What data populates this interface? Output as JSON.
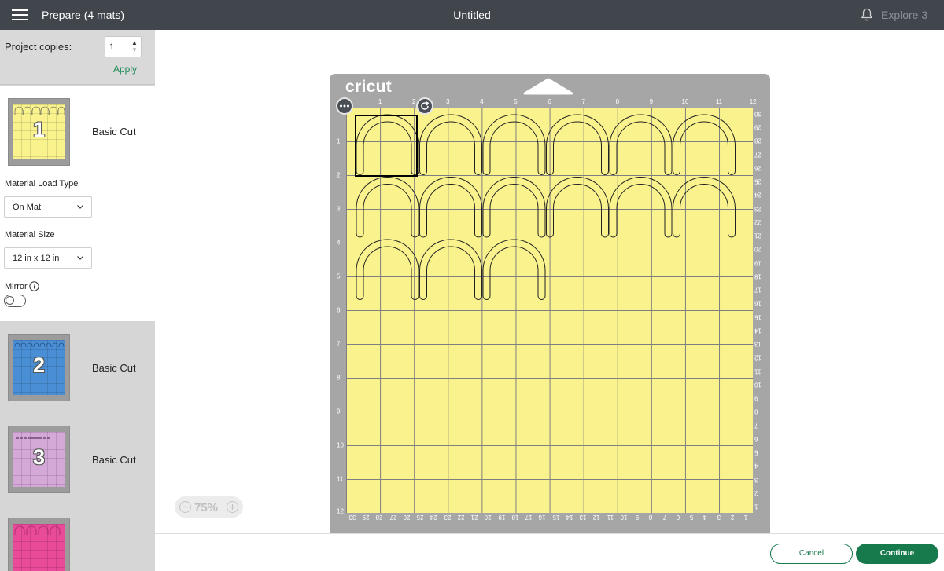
{
  "header": {
    "app_title": "Prepare (4 mats)",
    "doc_title": "Untitled",
    "machine": "Explore 3"
  },
  "sidebar": {
    "copies_label": "Project copies:",
    "copies_value": "1",
    "apply_label": "Apply",
    "mats": [
      {
        "number": "1",
        "label": "Basic Cut",
        "color": "#f9f28d"
      },
      {
        "number": "2",
        "label": "Basic Cut",
        "color": "#4a8fd6"
      },
      {
        "number": "3",
        "label": "Basic Cut",
        "color": "#d4a9d8"
      },
      {
        "number": "",
        "label": "",
        "color": "#e94a9a"
      }
    ],
    "material_load_type_label": "Material Load Type",
    "material_load_type_value": "On Mat",
    "material_size_label": "Material Size",
    "material_size_value": "12 in x 12 in",
    "mirror_label": "Mirror",
    "mirror_on": false
  },
  "canvas": {
    "brand": "cricut",
    "mat_color": "#f9f28d",
    "ruler_top": [
      "1",
      "2",
      "3",
      "4",
      "5",
      "6",
      "7",
      "8",
      "9",
      "10",
      "11",
      "12"
    ],
    "ruler_left": [
      "1",
      "2",
      "3",
      "4",
      "5",
      "6",
      "7",
      "8",
      "9",
      "10",
      "11",
      "12"
    ],
    "ruler_right": [
      "30",
      "29",
      "28",
      "27",
      "26",
      "25",
      "24",
      "23",
      "22",
      "21",
      "20",
      "19",
      "18",
      "17",
      "16",
      "15",
      "14",
      "13",
      "12",
      "11",
      "10",
      "9",
      "8",
      "7",
      "6",
      "5",
      "4",
      "3",
      "2",
      "1"
    ],
    "ruler_bottom": [
      "30",
      "29",
      "28",
      "27",
      "26",
      "25",
      "24",
      "23",
      "22",
      "21",
      "20",
      "19",
      "18",
      "17",
      "16",
      "15",
      "14",
      "13",
      "12",
      "11",
      "10",
      "9",
      "8",
      "7",
      "6",
      "5",
      "4",
      "3",
      "2",
      "1"
    ],
    "arch_rows": [
      6,
      6,
      3
    ],
    "zoom": "75%"
  },
  "footer": {
    "cancel_label": "Cancel",
    "continue_label": "Continue"
  }
}
